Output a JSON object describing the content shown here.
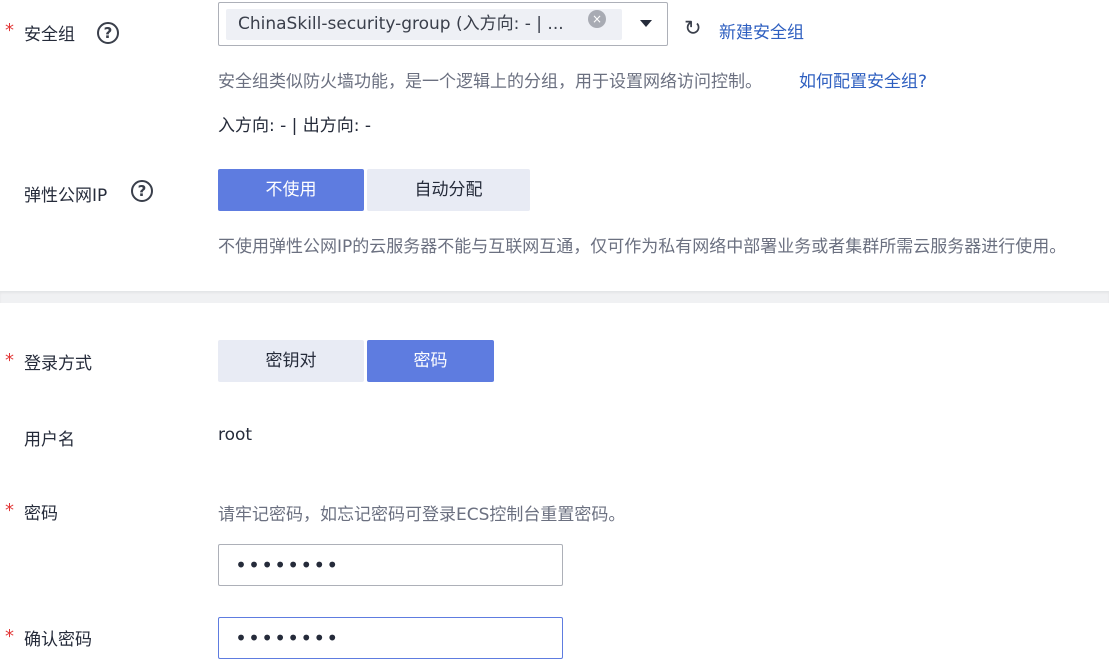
{
  "security_group": {
    "required_mark": "*",
    "label": "安全组",
    "help_icon": "?",
    "selected_tag": "ChinaSkill-security-group (入方向: - | ...",
    "tag_clear_icon": "×",
    "refresh_icon": "↻",
    "new_link": "新建安全组",
    "description": "安全组类似防火墙功能，是一个逻辑上的分组，用于设置网络访问控制。",
    "config_link": "如何配置安全组?",
    "direction_summary": "入方向: - | 出方向: -"
  },
  "eip": {
    "label": "弹性公网IP",
    "help_icon": "?",
    "options": [
      "不使用",
      "自动分配"
    ],
    "selected": "不使用",
    "description": "不使用弹性公网IP的云服务器不能与互联网互通，仅可作为私有网络中部署业务或者集群所需云服务器进行使用。"
  },
  "login": {
    "required_mark": "*",
    "label": "登录方式",
    "options": [
      "密钥对",
      "密码"
    ],
    "selected": "密码"
  },
  "username": {
    "label": "用户名",
    "value": "root"
  },
  "password": {
    "required_mark": "*",
    "label": "密码",
    "hint": "请牢记密码，如忘记密码可登录ECS控制台重置密码。",
    "value": "••••••••"
  },
  "confirm_password": {
    "required_mark": "*",
    "label": "确认密码",
    "value": "••••••••"
  },
  "colors": {
    "accent": "#5e7ce0",
    "link": "#2e5fc0",
    "required": "#e23838"
  }
}
